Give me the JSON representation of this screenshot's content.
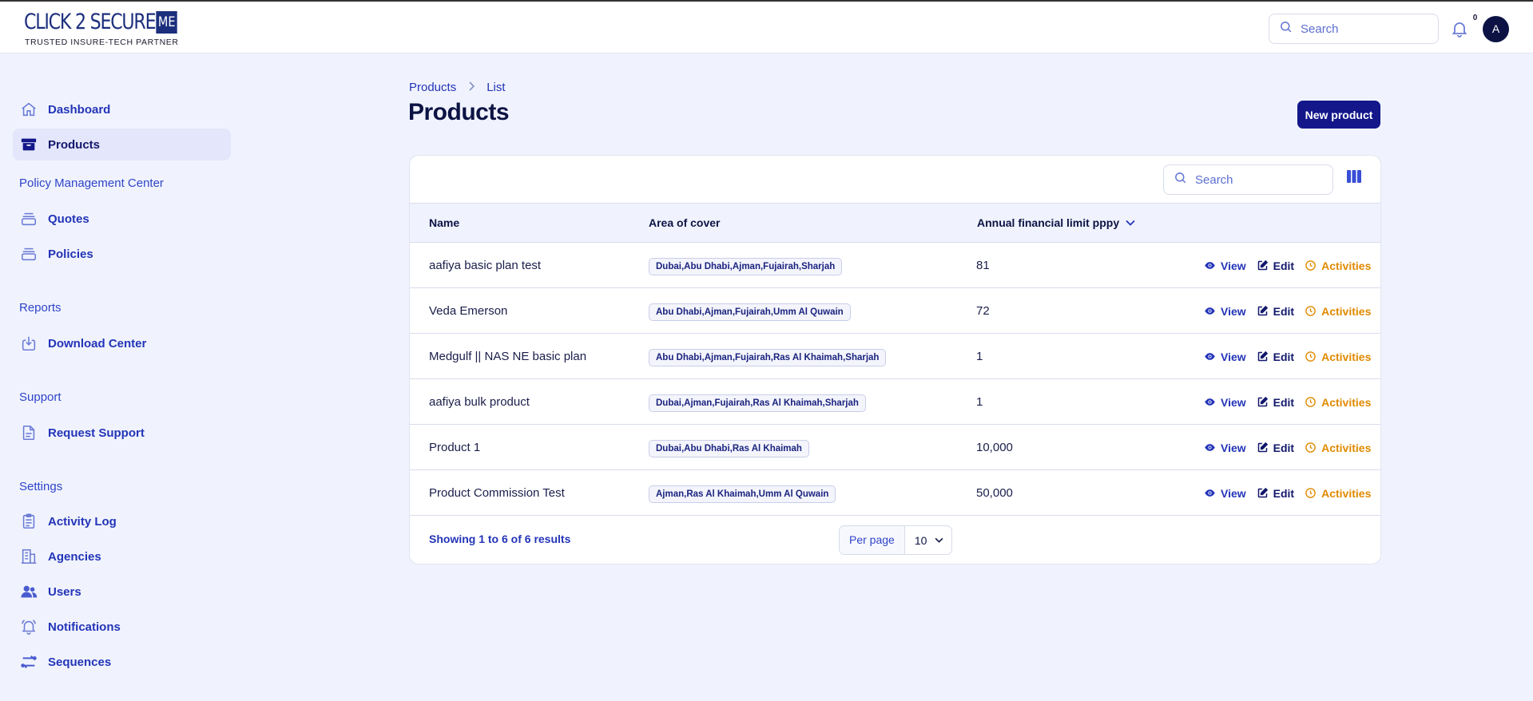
{
  "brand": {
    "name": "CLICK 2 SECURE",
    "badge": "ME",
    "tagline": "TRUSTED INSURE-TECH PARTNER"
  },
  "topbar": {
    "search_placeholder": "Search",
    "notification_count": "0",
    "avatar_initial": "A"
  },
  "sidebar": {
    "items": [
      {
        "label": "Dashboard",
        "icon": "home-icon"
      },
      {
        "label": "Products",
        "icon": "archive-box-icon",
        "active": true
      }
    ],
    "groups": [
      {
        "title": "Policy Management Center",
        "items": [
          {
            "label": "Quotes",
            "icon": "stack-icon"
          },
          {
            "label": "Policies",
            "icon": "stack-icon"
          }
        ]
      },
      {
        "title": "Reports",
        "items": [
          {
            "label": "Download Center",
            "icon": "download-tray-icon"
          }
        ]
      },
      {
        "title": "Support",
        "items": [
          {
            "label": "Request Support",
            "icon": "document-icon"
          }
        ]
      },
      {
        "title": "Settings",
        "items": [
          {
            "label": "Activity Log",
            "icon": "clipboard-list-icon"
          },
          {
            "label": "Agencies",
            "icon": "building-icon"
          },
          {
            "label": "Users",
            "icon": "users-icon"
          },
          {
            "label": "Notifications",
            "icon": "bell-icon"
          },
          {
            "label": "Sequences",
            "icon": "arrows-swap-icon"
          }
        ]
      }
    ]
  },
  "breadcrumb": [
    "Products",
    "List"
  ],
  "page": {
    "title": "Products",
    "new_button": "New product"
  },
  "table": {
    "search_placeholder": "Search",
    "columns": [
      "Name",
      "Area of cover",
      "Annual financial limit pppy"
    ],
    "sorted_column": "Annual financial limit pppy",
    "rows": [
      {
        "name": "aafiya basic plan test",
        "area": "Dubai,Abu Dhabi,Ajman,Fujairah,Sharjah",
        "limit": "81"
      },
      {
        "name": "Veda Emerson",
        "area": "Abu Dhabi,Ajman,Fujairah,Umm Al Quwain",
        "limit": "72"
      },
      {
        "name": "Medgulf || NAS NE basic plan",
        "area": "Abu Dhabi,Ajman,Fujairah,Ras Al Khaimah,Sharjah",
        "limit": "1"
      },
      {
        "name": "aafiya bulk product",
        "area": "Dubai,Ajman,Fujairah,Ras Al Khaimah,Sharjah",
        "limit": "1"
      },
      {
        "name": "Product 1",
        "area": "Dubai,Abu Dhabi,Ras Al Khaimah",
        "limit": "10,000"
      },
      {
        "name": "Product Commission Test",
        "area": "Ajman,Ras Al Khaimah,Umm Al Quwain",
        "limit": "50,000"
      }
    ],
    "actions": {
      "view": "View",
      "edit": "Edit",
      "activities": "Activities"
    },
    "footer": {
      "showing": "Showing 1 to 6 of 6 results",
      "per_page_label": "Per page",
      "per_page_value": "10"
    }
  },
  "colors": {
    "primary": "#13178a",
    "link": "#2334b8",
    "activities": "#e08a00",
    "background": "#f0f3fd"
  }
}
